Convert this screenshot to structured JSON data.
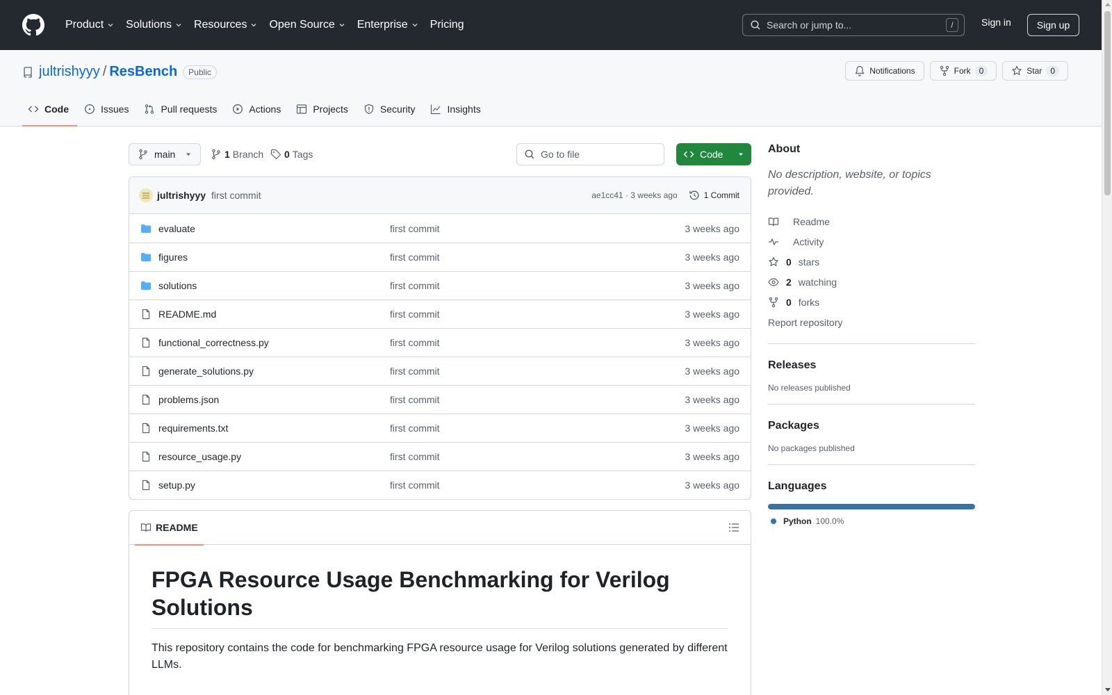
{
  "header": {
    "nav": [
      {
        "label": "Product",
        "dropdown": true
      },
      {
        "label": "Solutions",
        "dropdown": true
      },
      {
        "label": "Resources",
        "dropdown": true
      },
      {
        "label": "Open Source",
        "dropdown": true
      },
      {
        "label": "Enterprise",
        "dropdown": true
      },
      {
        "label": "Pricing",
        "dropdown": false
      }
    ],
    "search_placeholder": "Search or jump to...",
    "search_key": "/",
    "signin": "Sign in",
    "signup": "Sign up"
  },
  "repo": {
    "owner": "jultrishyyy",
    "separator": "/",
    "name": "ResBench",
    "visibility": "Public",
    "actions": {
      "notifications": "Notifications",
      "fork": "Fork",
      "fork_count": "0",
      "star": "Star",
      "star_count": "0"
    },
    "tabs": [
      {
        "label": "Code",
        "icon": "code-icon",
        "active": true
      },
      {
        "label": "Issues",
        "icon": "issue-icon",
        "active": false
      },
      {
        "label": "Pull requests",
        "icon": "pull-request-icon",
        "active": false
      },
      {
        "label": "Actions",
        "icon": "play-icon",
        "active": false
      },
      {
        "label": "Projects",
        "icon": "table-icon",
        "active": false
      },
      {
        "label": "Security",
        "icon": "shield-icon",
        "active": false
      },
      {
        "label": "Insights",
        "icon": "graph-icon",
        "active": false
      }
    ]
  },
  "toolbar": {
    "branch": "main",
    "branch_count": "1",
    "branch_label": "Branch",
    "tag_count": "0",
    "tag_label": "Tags",
    "goto_placeholder": "Go to file",
    "code_button": "Code"
  },
  "latest_commit": {
    "author": "jultrishyyy",
    "message": "first commit",
    "hash_time": "ae1cc41 · 3 weeks ago",
    "count": "1 Commit"
  },
  "files": [
    {
      "name": "evaluate",
      "type": "folder",
      "message": "first commit",
      "time": "3 weeks ago"
    },
    {
      "name": "figures",
      "type": "folder",
      "message": "first commit",
      "time": "3 weeks ago"
    },
    {
      "name": "solutions",
      "type": "folder",
      "message": "first commit",
      "time": "3 weeks ago"
    },
    {
      "name": "README.md",
      "type": "file",
      "message": "first commit",
      "time": "3 weeks ago"
    },
    {
      "name": "functional_correctness.py",
      "type": "file",
      "message": "first commit",
      "time": "3 weeks ago"
    },
    {
      "name": "generate_solutions.py",
      "type": "file",
      "message": "first commit",
      "time": "3 weeks ago"
    },
    {
      "name": "problems.json",
      "type": "file",
      "message": "first commit",
      "time": "3 weeks ago"
    },
    {
      "name": "requirements.txt",
      "type": "file",
      "message": "first commit",
      "time": "3 weeks ago"
    },
    {
      "name": "resource_usage.py",
      "type": "file",
      "message": "first commit",
      "time": "3 weeks ago"
    },
    {
      "name": "setup.py",
      "type": "file",
      "message": "first commit",
      "time": "3 weeks ago"
    }
  ],
  "readme": {
    "tab": "README",
    "title": "FPGA Resource Usage Benchmarking for Verilog Solutions",
    "body": "This repository contains the code for benchmarking FPGA resource usage for Verilog solutions generated by different LLMs."
  },
  "sidebar": {
    "about_title": "About",
    "about_desc": "No description, website, or topics provided.",
    "links": [
      {
        "icon": "book-icon",
        "count": "",
        "label": "Readme"
      },
      {
        "icon": "pulse-icon",
        "count": "",
        "label": "Activity"
      },
      {
        "icon": "star-icon",
        "count": "0",
        "label": "stars"
      },
      {
        "icon": "eye-icon",
        "count": "2",
        "label": "watching"
      },
      {
        "icon": "fork-icon",
        "count": "0",
        "label": "forks"
      }
    ],
    "report": "Report repository",
    "releases_title": "Releases",
    "releases_text": "No releases published",
    "packages_title": "Packages",
    "packages_text": "No packages published",
    "languages_title": "Languages",
    "languages": [
      {
        "name": "Python",
        "percent": "100.0%",
        "color": "#3572A5",
        "fraction": 1.0
      }
    ]
  },
  "colors": {
    "header_bg": "#24292f",
    "accent": "#0969da",
    "code_button": "#1f883d",
    "tab_underline": "#fd8c73"
  }
}
